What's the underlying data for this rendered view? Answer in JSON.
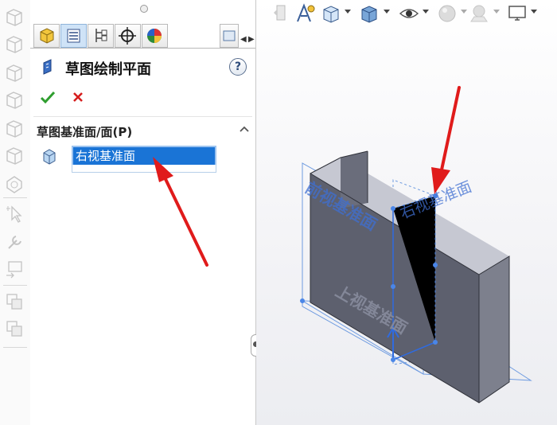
{
  "panel": {
    "title": "草图绘制平面",
    "help_label": "?",
    "ok_icon": "checkmark-icon",
    "cancel_icon": "x-icon",
    "section_title": "草图基准面/面(P)",
    "selected_plane": "右视基准面"
  },
  "viewport": {
    "plane_labels": {
      "front": "前视基准面",
      "right": "右视基准面",
      "top": "上视基准面"
    }
  },
  "colors": {
    "selection_blue": "#1a74d6",
    "annotation_red": "#e01b1b",
    "plane_label_blue": "#3f6fd1",
    "body_gray": "#5d606e"
  }
}
